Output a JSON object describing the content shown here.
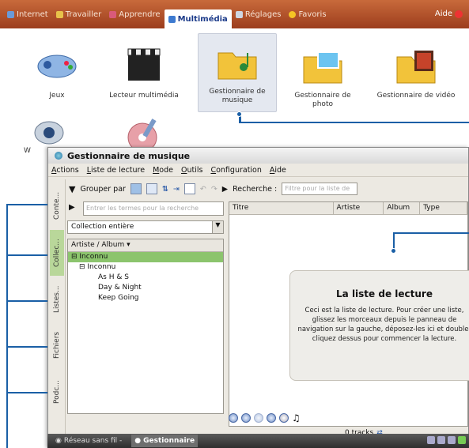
{
  "topbar": {
    "tabs": [
      {
        "label": "Internet",
        "icon": "globe-icon"
      },
      {
        "label": "Travailler",
        "icon": "briefcase-icon"
      },
      {
        "label": "Apprendre",
        "icon": "book-icon"
      },
      {
        "label": "Multimédia",
        "icon": "media-icon"
      },
      {
        "label": "Réglages",
        "icon": "wrench-icon"
      },
      {
        "label": "Favoris",
        "icon": "star-icon"
      }
    ],
    "help": "Aide"
  },
  "launcher": {
    "apps": [
      {
        "label": "Jeux",
        "icon": "gamepad-icon"
      },
      {
        "label": "Lecteur multimédia",
        "icon": "clapperboard-icon"
      },
      {
        "label": "Gestionnaire de musique",
        "icon": "music-folder-icon"
      },
      {
        "label": "Gestionnaire de photo",
        "icon": "photo-folder-icon"
      },
      {
        "label": "Gestionnaire de vidéo",
        "icon": "video-folder-icon"
      }
    ],
    "partial_label": "W"
  },
  "window": {
    "title": "Gestionnaire de musique",
    "menu": [
      "Actions",
      "Liste de lecture",
      "Mode",
      "Outils",
      "Configuration",
      "Aide"
    ],
    "toolbar": {
      "group_label": "Grouper par",
      "search_label": "Recherche :",
      "search_placeholder": "Filtre pour la liste de"
    },
    "side_tabs": [
      "Conte...",
      "Collec...",
      "Listes...",
      "Fichiers",
      "Podc..."
    ],
    "filter_placeholder": "Entrer les termes pour la recherche",
    "collection_combo": "Collection entière",
    "tree": {
      "header": "Artiste / Album",
      "rows": [
        "Inconnu",
        "Inconnu",
        "As H & S",
        "Day & Night",
        "Keep Going"
      ]
    },
    "playlist": {
      "columns": [
        "Titre",
        "Artiste",
        "Album",
        "Type"
      ],
      "info_title": "La liste de lecture",
      "info_text": "Ceci est la liste de lecture. Pour créer une liste, glissez les morceaux depuis le panneau de navigation sur la gauche, déposez-les ici et double-cliquez dessus pour commencer la lecture."
    },
    "tracks": "0 tracks"
  },
  "taskbar": {
    "items": [
      "Réseau sans fil -",
      "Gestionnaire"
    ]
  }
}
